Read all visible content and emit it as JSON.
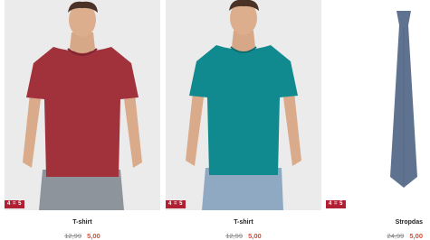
{
  "products": [
    {
      "name": "T-shirt",
      "old_price": "12,99",
      "new_price": "5,00",
      "badge": "4 = 5",
      "shirt_color": "#a1323c"
    },
    {
      "name": "T-shirt",
      "old_price": "12,99",
      "new_price": "5,00",
      "badge": "4 = 5",
      "shirt_color": "#108a8f"
    },
    {
      "name": "Stropdas",
      "old_price": "24,99",
      "new_price": "5,00",
      "badge": "4 = 5",
      "tie_color": "#5f7391"
    }
  ]
}
